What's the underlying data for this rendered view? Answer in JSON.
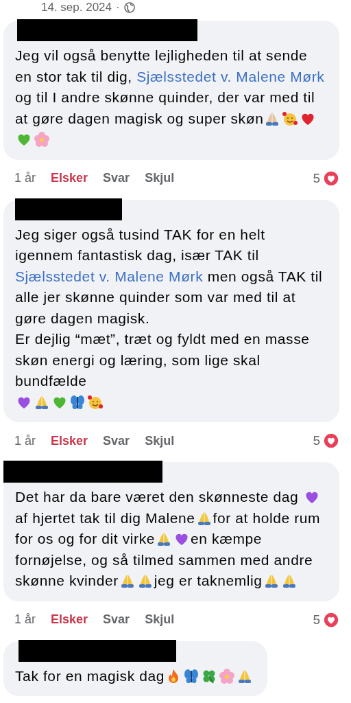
{
  "post_meta": {
    "date": "14. sep. 2024",
    "separator": "·",
    "audience": {
      "kind": "public"
    }
  },
  "comments": [
    {
      "author_redacted": true,
      "body": [
        {
          "kind": "text",
          "text": "Jeg vil også benytte lejligheden til at sende en stor tak til dig, "
        },
        {
          "kind": "link",
          "text": "Sjælsstedet v. Malene Mørk"
        },
        {
          "kind": "text",
          "text": " og til I andre skønne quinder, der var med til at gøre dagen magisk og super skøn"
        },
        {
          "kind": "pray",
          "color": "#e7c4a0"
        },
        {
          "kind": "face"
        },
        {
          "kind": "heart",
          "color": "#e0242f"
        },
        {
          "kind": "heart",
          "color": "#4db635"
        },
        {
          "kind": "flower"
        }
      ],
      "meta": {
        "age": "1 år",
        "love": {
          "label": "Elsker",
          "selected": true
        },
        "reply": "Svar",
        "hide": "Skjul",
        "reaction_count": "5",
        "reaction": {
          "kind": "love"
        }
      }
    },
    {
      "author_redacted": true,
      "body": [
        {
          "kind": "text",
          "text": "Jeg siger også tusind TAK for en helt igennem fantastisk dag, især TAK til "
        },
        {
          "kind": "link",
          "text": "Sjælsstedet v. Malene Mørk"
        },
        {
          "kind": "text",
          "text": " men også TAK til alle jer skønne quinder som var med til at gøre dagen magisk.\nEr dejlig “mæt”, træt og fyldt med en masse skøn energi og læring, som lige skal bundfælde\n"
        },
        {
          "kind": "heart",
          "color": "#9b4fe0"
        },
        {
          "kind": "pray",
          "color": "#f4c53a"
        },
        {
          "kind": "heart",
          "color": "#4db635"
        },
        {
          "kind": "butterfly"
        },
        {
          "kind": "face"
        }
      ],
      "meta": {
        "age": "1 år",
        "love": {
          "label": "Elsker",
          "selected": true
        },
        "reply": "Svar",
        "hide": "Skjul",
        "reaction_count": "5",
        "reaction": {
          "kind": "love"
        }
      }
    },
    {
      "author_redacted": true,
      "body": [
        {
          "kind": "text",
          "text": "Det har da bare været den skønneste dag "
        },
        {
          "kind": "heart",
          "color": "#9b4fe0"
        },
        {
          "kind": "text",
          "text": "af hjertet tak til dig Malene"
        },
        {
          "kind": "pray",
          "color": "#f4c53a"
        },
        {
          "kind": "text",
          "text": "for at holde rum for os og for dit virke"
        },
        {
          "kind": "pray",
          "color": "#f4c53a"
        },
        {
          "kind": "heart",
          "color": "#9b4fe0"
        },
        {
          "kind": "text",
          "text": "en kæmpe fornøjelse, og så tilmed sammen med andre skønne kvinder"
        },
        {
          "kind": "pray",
          "color": "#f4c53a"
        },
        {
          "kind": "pray",
          "color": "#f4c53a"
        },
        {
          "kind": "text",
          "text": "jeg er taknemlig"
        },
        {
          "kind": "pray",
          "color": "#f4c53a"
        },
        {
          "kind": "pray",
          "color": "#f4c53a"
        }
      ],
      "meta": {
        "age": "1 år",
        "love": {
          "label": "Elsker",
          "selected": true
        },
        "reply": "Svar",
        "hide": "Skjul",
        "reaction_count": "5",
        "reaction": {
          "kind": "love"
        }
      }
    },
    {
      "author_redacted": true,
      "body": [
        {
          "kind": "text",
          "text": "Tak for en magisk dag"
        },
        {
          "kind": "fire"
        },
        {
          "kind": "butterfly"
        },
        {
          "kind": "clover"
        },
        {
          "kind": "flower"
        },
        {
          "kind": "pray",
          "color": "#f4c53a"
        }
      ]
    }
  ]
}
